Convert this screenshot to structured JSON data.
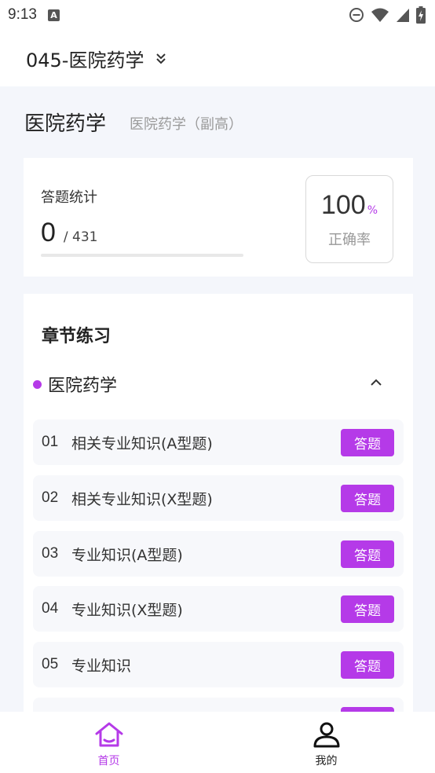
{
  "status_bar": {
    "time": "9:13",
    "notification_icon": "A"
  },
  "header": {
    "title": "045-医院药学"
  },
  "subject": {
    "name": "医院药学",
    "level": "医院药学（副高）"
  },
  "stats": {
    "label": "答题统计",
    "answered": "0",
    "total": "/ 431",
    "progress_fraction": 0,
    "accuracy_value": "100",
    "accuracy_unit": "%",
    "accuracy_label": "正确率"
  },
  "chapters": {
    "title": "章节练习",
    "group_name": "医院药学",
    "items": [
      {
        "no": "01",
        "name": "相关专业知识(A型题)",
        "button": "答题"
      },
      {
        "no": "02",
        "name": "相关专业知识(X型题)",
        "button": "答题"
      },
      {
        "no": "03",
        "name": "专业知识(A型题)",
        "button": "答题"
      },
      {
        "no": "04",
        "name": "专业知识(X型题)",
        "button": "答题"
      },
      {
        "no": "05",
        "name": "专业知识",
        "button": "答题"
      },
      {
        "no": "",
        "name": "",
        "button": ""
      }
    ]
  },
  "tabs": [
    {
      "label": "首页",
      "icon": "home-icon",
      "active": true
    },
    {
      "label": "我的",
      "icon": "user-icon",
      "active": false
    }
  ],
  "colors": {
    "accent": "#b53ae8",
    "background": "#f4f6fb"
  }
}
